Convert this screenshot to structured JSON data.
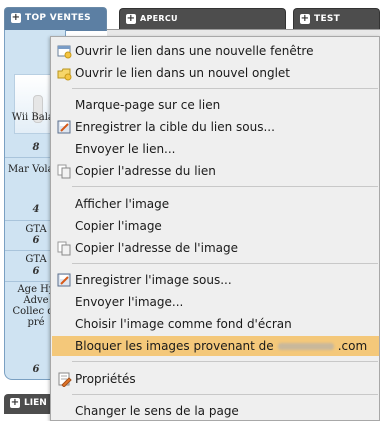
{
  "page": {
    "tabs": {
      "top_ventes": "Top Ventes",
      "apercu": "Apercu",
      "test": "Test",
      "liens": "Lien"
    },
    "side_items": [
      {
        "title": "Wii Balan",
        "rank": "8"
      },
      {
        "title": "Mar Volant",
        "rank": "4"
      },
      {
        "title": "GTA",
        "rank": "6"
      },
      {
        "title": "GTA",
        "rank": "6"
      },
      {
        "title": "Age Hy Adve Collec de pré",
        "rank": "6"
      }
    ]
  },
  "context_menu": {
    "items": {
      "open_new_window": {
        "label": "Ouvrir le lien dans une nouvelle fenêtre",
        "icon": "new-window-icon"
      },
      "open_new_tab": {
        "label": "Ouvrir le lien dans un nouvel onglet",
        "icon": "new-tab-icon"
      },
      "bookmark_link": {
        "label": "Marque-page sur ce lien"
      },
      "save_link_target": {
        "label": "Enregistrer la cible du lien sous...",
        "icon": "save-icon"
      },
      "send_link": {
        "label": "Envoyer le lien..."
      },
      "copy_link_address": {
        "label": "Copier l'adresse du lien",
        "icon": "copy-icon"
      },
      "view_image": {
        "label": "Afficher l'image"
      },
      "copy_image": {
        "label": "Copier l'image"
      },
      "copy_image_address": {
        "label": "Copier l'adresse de l'image",
        "icon": "copy-icon"
      },
      "save_image": {
        "label": "Enregistrer l'image sous...",
        "icon": "save-icon"
      },
      "send_image": {
        "label": "Envoyer l'image..."
      },
      "set_wallpaper": {
        "label": "Choisir l'image comme fond d'écran"
      },
      "block_images_prefix": {
        "label": "Bloquer les images provenant de"
      },
      "block_images_suffix": {
        "label": ".com"
      },
      "properties": {
        "label": "Propriétés",
        "icon": "properties-icon"
      },
      "change_direction": {
        "label": "Changer le sens de la page"
      }
    },
    "highlight_color": "#f4c87a"
  }
}
